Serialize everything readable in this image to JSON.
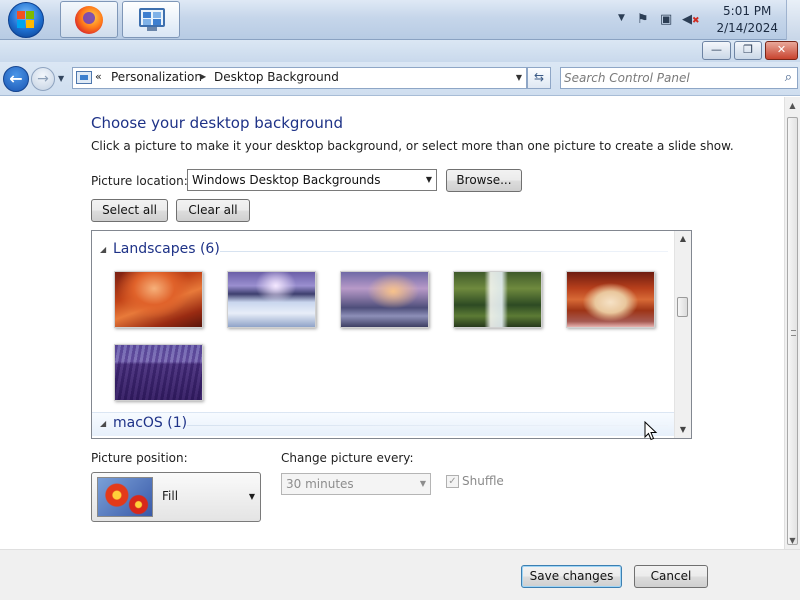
{
  "taskbar": {
    "apps": [
      {
        "name": "Firefox",
        "icon": "firefox-icon"
      },
      {
        "name": "Control Panel",
        "icon": "control-panel-icon"
      }
    ],
    "clock": {
      "time": "5:01 PM",
      "date": "2/14/2024"
    },
    "tray_icons": [
      "show-hidden-icons-arrow",
      "action-center-flag-icon",
      "network-icon",
      "volume-muted-icon"
    ]
  },
  "window": {
    "caption_buttons": {
      "minimize": "—",
      "maximize": "❐",
      "close": "✕"
    }
  },
  "navigation": {
    "back_icon": "back-arrow-icon",
    "forward_icon": "forward-arrow-icon",
    "address": {
      "overflow": "«",
      "crumbs": [
        "Personalization",
        "Desktop Background"
      ]
    },
    "search": {
      "placeholder": "Search Control Panel"
    }
  },
  "main": {
    "title": "Choose your desktop background",
    "description": "Click a picture to make it your desktop background, or select more than one picture to create a slide show.",
    "picture_location": {
      "label": "Picture location:",
      "value": "Windows Desktop Backgrounds"
    },
    "browse_label": "Browse...",
    "select_all_label": "Select all",
    "clear_all_label": "Clear all",
    "groups": [
      {
        "label": "Landscapes (6)",
        "images": [
          "red sandstone canyon",
          "frozen lake with mountains",
          "rocky coast at dusk",
          "waterfall in forest",
          "rock arch at sunset",
          "lavender field"
        ]
      },
      {
        "label": "macOS (1)",
        "images": []
      }
    ],
    "picture_position": {
      "label": "Picture position:",
      "value": "Fill"
    },
    "change_picture": {
      "label": "Change picture every:",
      "value": "30 minutes"
    },
    "shuffle": {
      "label": "Shuffle",
      "checked": true,
      "enabled": false
    }
  },
  "footer": {
    "save_label": "Save changes",
    "cancel_label": "Cancel"
  },
  "colors": {
    "heading": "#1e3287",
    "taskbar": "#c6d6ea",
    "default_button_border": "#3c7fb1"
  }
}
